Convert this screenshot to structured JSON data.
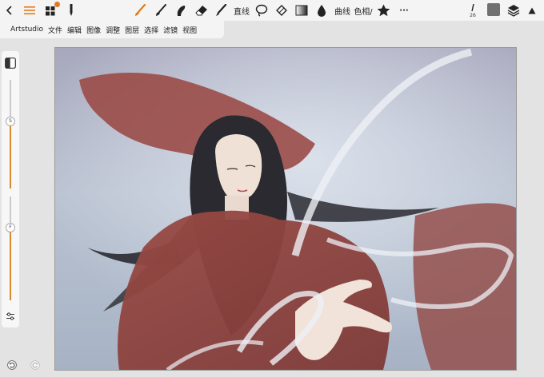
{
  "toolbar": {
    "line_label": "直线",
    "curve_label": "曲线",
    "hue_label": "色相/",
    "more_label": "···",
    "brush_size": "26",
    "layer_badge": "",
    "icons": [
      "back-icon",
      "menu-icon",
      "gallery-icon",
      "pencil-tool-icon",
      "brush-icon",
      "brush-alt-icon",
      "smudge-icon",
      "eraser-icon",
      "pen-icon",
      "lasso-icon",
      "transform-icon",
      "gradient-icon",
      "fill-icon",
      "star-icon",
      "brush-size-icon",
      "color-swatch",
      "layers-icon",
      "collapse-icon"
    ],
    "accent_color": "#e07b1f",
    "swatch_color": "#707070"
  },
  "menu": {
    "items": [
      "Artstudio",
      "文件",
      "编辑",
      "图像",
      "调整",
      "图层",
      "选择",
      "滤镜",
      "视图"
    ]
  },
  "sidepanel": {
    "size_knob": "S",
    "opacity_knob": "F",
    "size_level": 0.62,
    "opacity_level": 0.7
  },
  "history": {
    "icons": [
      "undo-icon",
      "redo-icon"
    ]
  }
}
